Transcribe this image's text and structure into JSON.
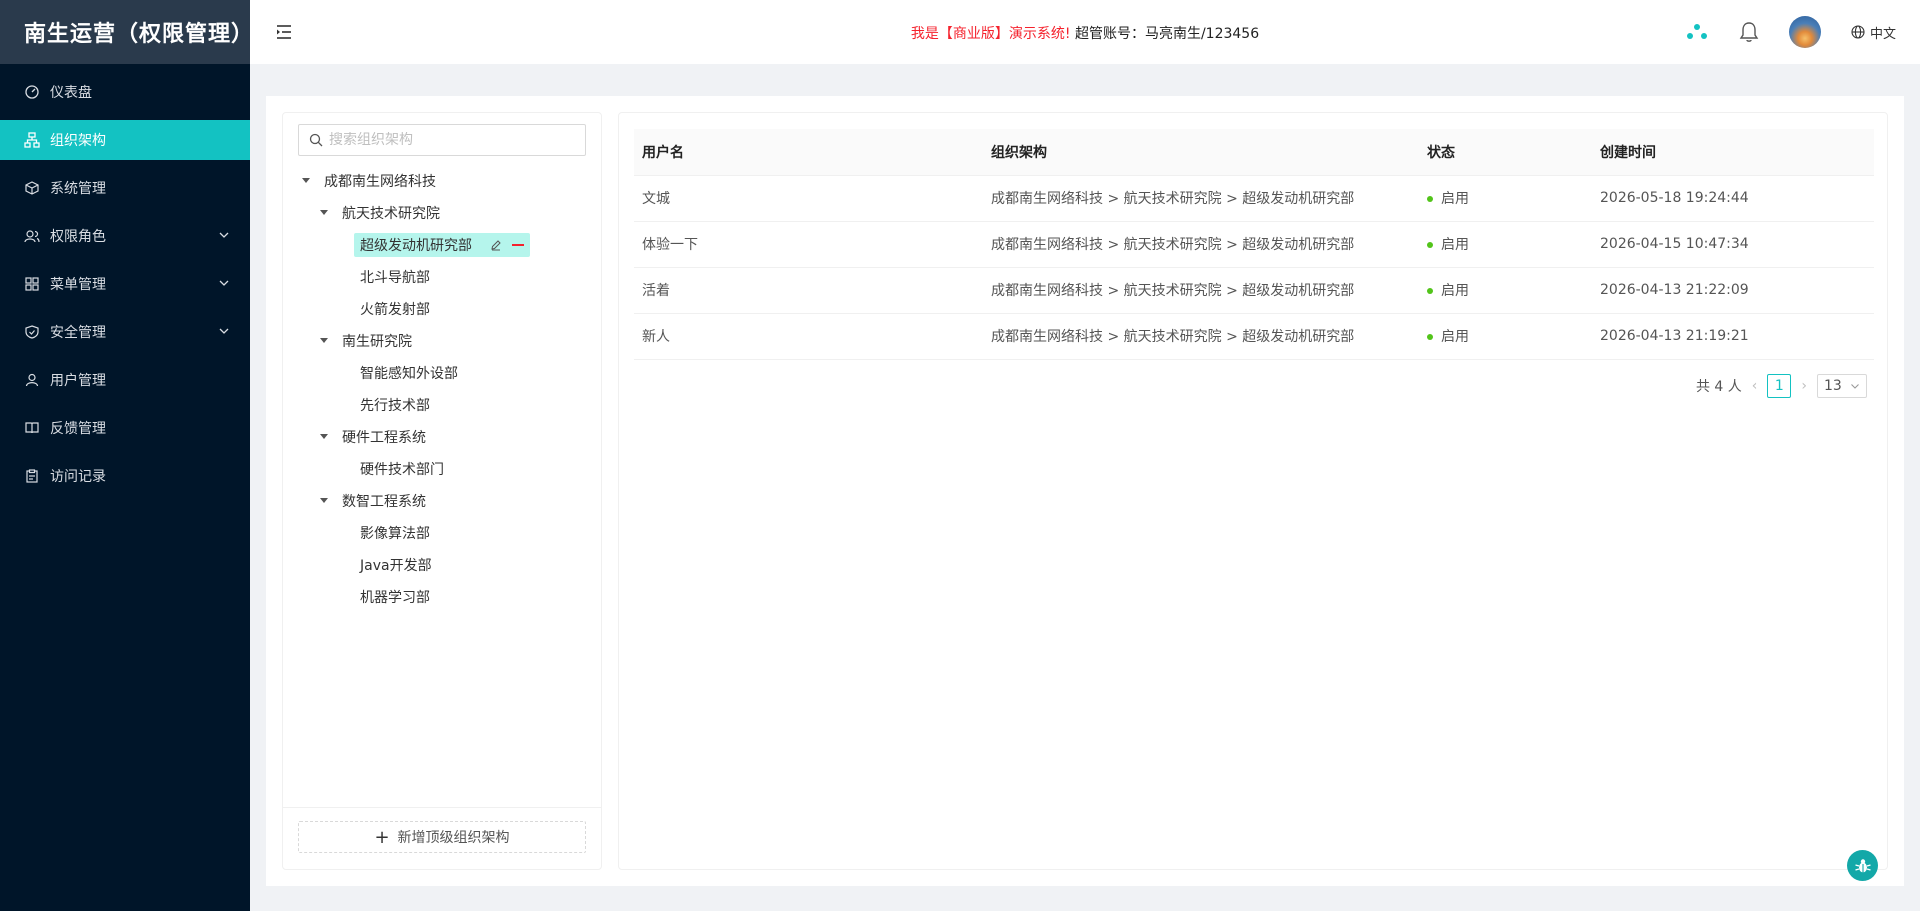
{
  "app": {
    "title": "南生运营（权限管理）"
  },
  "sidebar": {
    "items": [
      {
        "label": "仪表盘",
        "icon": "dashboard-icon",
        "active": false
      },
      {
        "label": "组织架构",
        "icon": "org-chart-icon",
        "active": true
      },
      {
        "label": "系统管理",
        "icon": "cube-icon",
        "active": false
      },
      {
        "label": "权限角色",
        "icon": "users-icon",
        "active": false,
        "expandable": true
      },
      {
        "label": "菜单管理",
        "icon": "grid-icon",
        "active": false,
        "expandable": true
      },
      {
        "label": "安全管理",
        "icon": "shield-icon",
        "active": false,
        "expandable": true
      },
      {
        "label": "用户管理",
        "icon": "user-icon",
        "active": false
      },
      {
        "label": "反馈管理",
        "icon": "book-icon",
        "active": false
      },
      {
        "label": "访问记录",
        "icon": "clipboard-icon",
        "active": false
      }
    ]
  },
  "header": {
    "notice_red": "我是【商业版】演示系统!",
    "notice_black": "超管账号：马亮南生/123456",
    "lang": "中文"
  },
  "tree": {
    "search_placeholder": "搜索组织架构",
    "root": "成都南生网络科技",
    "groups": [
      {
        "label": "航天技术研究院",
        "children": [
          "超级发动机研究部",
          "北斗导航部",
          "火箭发射部"
        ]
      },
      {
        "label": "南生研究院",
        "children": [
          "智能感知外设部",
          "先行技术部"
        ]
      },
      {
        "label": "硬件工程系统",
        "children": [
          "硬件技术部门"
        ]
      },
      {
        "label": "数智工程系统",
        "children": [
          "影像算法部",
          "Java开发部",
          "机器学习部"
        ]
      }
    ],
    "add_top_label": "新增顶级组织架构"
  },
  "table": {
    "columns": [
      "用户名",
      "组织架构",
      "状态",
      "创建时间"
    ],
    "rows": [
      [
        "文城",
        "成都南生网络科技 > 航天技术研究院 > 超级发动机研究部",
        "启用",
        "2026-05-18 19:24:44"
      ],
      [
        "体验一下",
        "成都南生网络科技 > 航天技术研究院 > 超级发动机研究部",
        "启用",
        "2026-04-15 10:47:34"
      ],
      [
        "活着",
        "成都南生网络科技 > 航天技术研究院 > 超级发动机研究部",
        "启用",
        "2026-04-13 21:22:09"
      ],
      [
        "新人",
        "成都南生网络科技 > 航天技术研究院 > 超级发动机研究部",
        "启用",
        "2026-04-13 21:19:21"
      ]
    ]
  },
  "pager": {
    "total": "共 4 人",
    "current": "1",
    "page_size": "13"
  },
  "colors": {
    "accent": "#13c2c2",
    "sidebar_bg": "#001529",
    "status_on": "#52c41a",
    "notice": "#f5222d"
  }
}
